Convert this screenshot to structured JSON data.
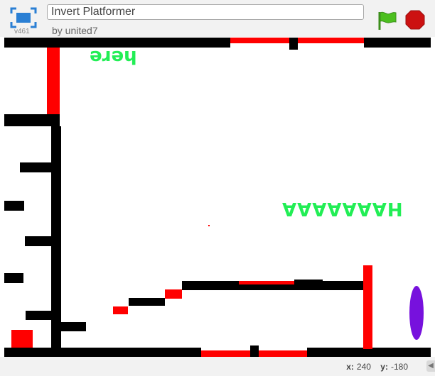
{
  "header": {
    "project_title": "Invert Platformer",
    "author": "by united7",
    "version": "v461"
  },
  "controls": {
    "fullscreen_icon": "fullscreen-icon",
    "green_flag_icon": "green-flag-icon",
    "stop_icon": "stop-sign-icon"
  },
  "stage": {
    "texts": {
      "here": "here",
      "haaa": "HAAAAAAA"
    },
    "colors": {
      "wall": "#000000",
      "hazard": "#ff0000",
      "text": "#22ee55",
      "portal": "#7711dd"
    }
  },
  "status": {
    "x_label": "x:",
    "x_value": "240",
    "y_label": "y:",
    "y_value": "-180"
  }
}
